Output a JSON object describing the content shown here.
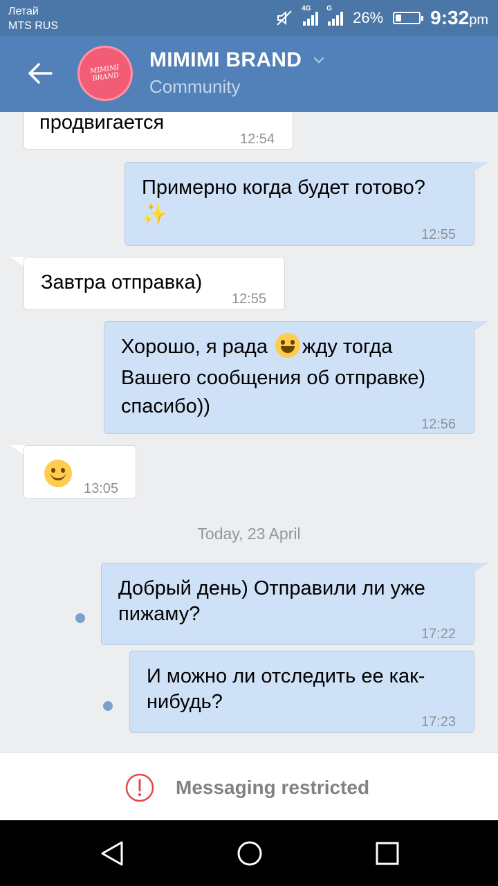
{
  "status_bar": {
    "carrier_line1": "Летай",
    "carrier_line2": "MTS RUS",
    "network1": "4G",
    "network2": "G",
    "battery_pct": "26%",
    "battery_level": 0.26,
    "time": "9:32",
    "time_suffix": "pm"
  },
  "header": {
    "title": "MIMIMI BRAND",
    "subtitle": "Community",
    "avatar_text": "MIMIMI BRAND"
  },
  "messages": [
    {
      "dir": "in",
      "text": "продвигается",
      "time": "12:54"
    },
    {
      "dir": "out",
      "text": "Примерно когда будет готово?",
      "emoji": "✨",
      "time": "12:55"
    },
    {
      "dir": "in",
      "text": "Завтра отправка)",
      "time": "12:55"
    },
    {
      "dir": "out",
      "text1": "Хорошо, я рада",
      "emoji": "grinning-face",
      "text2": "жду тогда",
      "line2": "Вашего сообщения об отправке)",
      "line3": "спасибо))",
      "time": "12:56"
    },
    {
      "dir": "in",
      "emoji": "smiling-face",
      "time": "13:05"
    },
    {
      "dir": "out",
      "line1": "Добрый день) Отправили ли уже",
      "line2": "пижаму?",
      "time": "17:22",
      "unread": true
    },
    {
      "dir": "out",
      "line1": "И можно ли отследить ее как-",
      "line2": "нибудь?",
      "time": "17:23",
      "unread": true
    }
  ],
  "date_separator": "Today, 23 April",
  "footer": {
    "restricted_label": "Messaging restricted"
  },
  "colors": {
    "header": "#5181b8",
    "status_bar": "#4a76a8",
    "out_bubble": "#cfe1f6",
    "in_bubble": "#ffffff",
    "alert": "#e64646"
  }
}
